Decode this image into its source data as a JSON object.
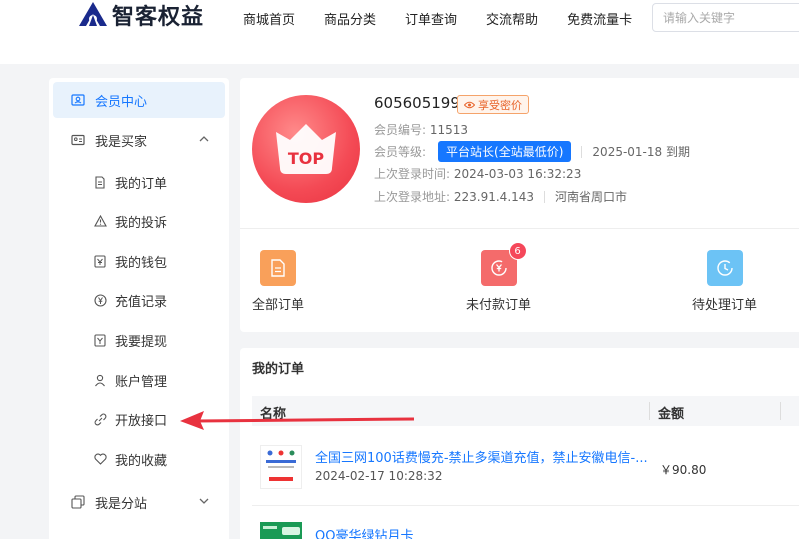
{
  "header": {
    "logo_text": "智客权益",
    "nav": [
      "商城首页",
      "商品分类",
      "订单查询",
      "交流帮助",
      "免费流量卡"
    ],
    "search_placeholder": "请输入关键字"
  },
  "sidebar": {
    "member_center": "会员中心",
    "buyer_group": "我是买家",
    "buyer_items": [
      {
        "label": "我的订单",
        "icon": "document-icon"
      },
      {
        "label": "我的投诉",
        "icon": "warning-icon"
      },
      {
        "label": "我的钱包",
        "icon": "wallet-icon"
      },
      {
        "label": "充值记录",
        "icon": "yen-circle-icon"
      },
      {
        "label": "我要提现",
        "icon": "withdraw-icon"
      },
      {
        "label": "账户管理",
        "icon": "user-icon"
      },
      {
        "label": "开放接口",
        "icon": "link-icon"
      },
      {
        "label": "我的收藏",
        "icon": "heart-icon"
      }
    ],
    "substation_group": "我是分站"
  },
  "profile": {
    "uid": "605605199",
    "vip_label": "享受密价",
    "member_no_label": "会员编号:",
    "member_no": "11513",
    "level_label": "会员等级:",
    "level": "平台站长(全站最低价)",
    "expire": "2025-01-18 到期",
    "last_login_time_label": "上次登录时间:",
    "last_login_time": "2024-03-03 16:32:23",
    "last_login_addr_label": "上次登录地址:",
    "last_login_ip": "223.91.4.143",
    "last_login_region": "河南省周口市",
    "avatar_text": "TOP"
  },
  "quick_actions": [
    {
      "label": "全部订单",
      "color": "#f9a05a"
    },
    {
      "label": "未付款订单",
      "color": "#f46b6b",
      "badge": "6"
    },
    {
      "label": "待处理订单",
      "color": "#6cc3f5"
    }
  ],
  "orders": {
    "title": "我的订单",
    "col_name": "名称",
    "col_amount": "金额",
    "rows": [
      {
        "name": "全国三网100话费慢充-禁止多渠道充值，禁止安徽电信-...",
        "time": "2024-02-17 10:28:32",
        "price": "￥90.80"
      },
      {
        "name": "QQ豪华绿钻月卡",
        "time": "",
        "price": ""
      }
    ]
  },
  "colors": {
    "accent": "#1677ff",
    "arrow": "#e8323f"
  }
}
